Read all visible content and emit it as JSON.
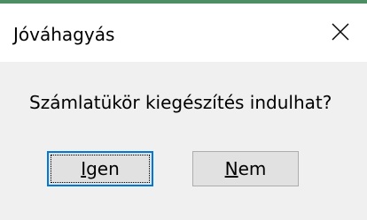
{
  "window": {
    "title": "Jóváhagyás",
    "close_icon": "close-icon"
  },
  "message": "Számlatükör kiegészítés indulhat?",
  "buttons": {
    "yes": {
      "mnemonic": "I",
      "rest": "gen"
    },
    "no": {
      "mnemonic": "N",
      "rest": "em"
    }
  },
  "colors": {
    "accent": "#4d8f63",
    "titlebar": "#ffffff",
    "body": "#f0f0f0",
    "button_face": "#e1e1e1",
    "focus_border": "#0078d7"
  }
}
